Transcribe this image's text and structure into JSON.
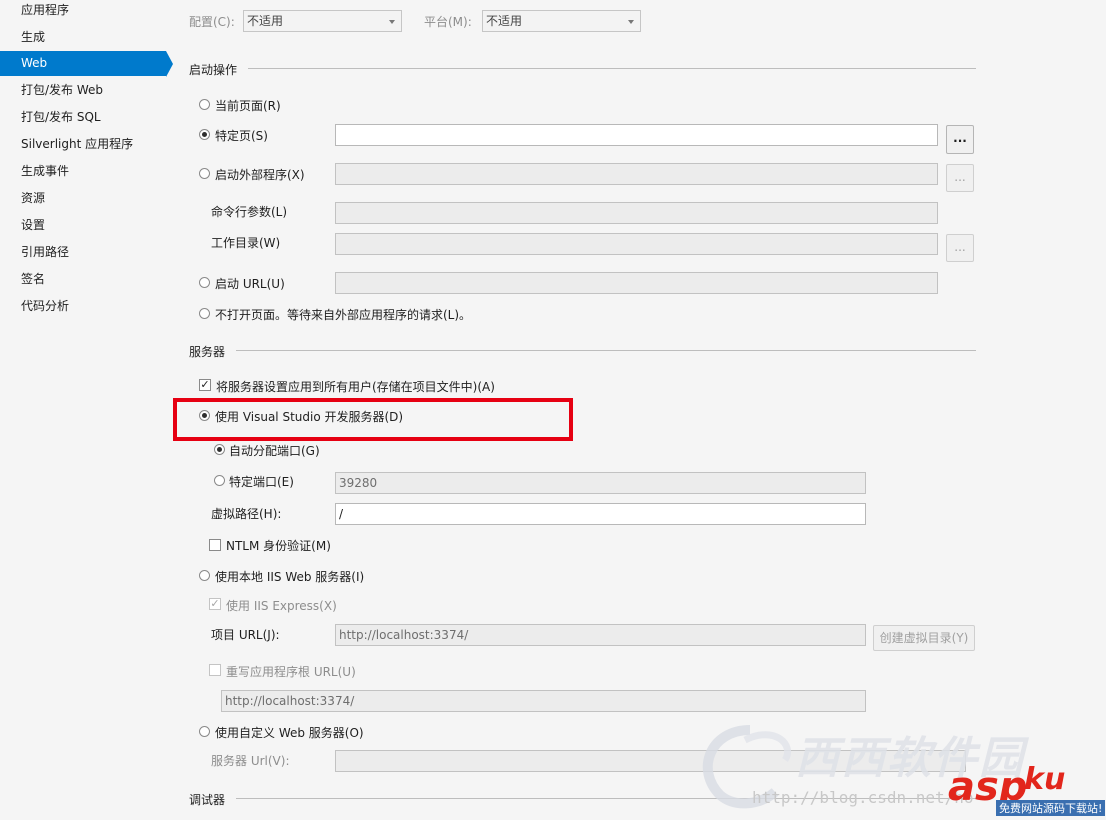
{
  "sidebar": {
    "items": [
      {
        "label": "应用程序",
        "active": false
      },
      {
        "label": "生成",
        "active": false
      },
      {
        "label": "Web",
        "active": true
      },
      {
        "label": "打包/发布 Web",
        "active": false
      },
      {
        "label": "打包/发布 SQL",
        "active": false
      },
      {
        "label": "Silverlight 应用程序",
        "active": false
      },
      {
        "label": "生成事件",
        "active": false
      },
      {
        "label": "资源",
        "active": false
      },
      {
        "label": "设置",
        "active": false
      },
      {
        "label": "引用路径",
        "active": false
      },
      {
        "label": "签名",
        "active": false
      },
      {
        "label": "代码分析",
        "active": false
      }
    ]
  },
  "toolbar": {
    "config_label": "配置(C):",
    "config_value": "不适用",
    "platform_label": "平台(M):",
    "platform_value": "不适用"
  },
  "start_action": {
    "title": "启动操作",
    "current_page": "当前页面(R)",
    "specific_page": "特定页(S)",
    "specific_page_value": "",
    "external_program": "启动外部程序(X)",
    "command_args": "命令行参数(L)",
    "working_dir": "工作目录(W)",
    "start_url": "启动 URL(U)",
    "dont_open": "不打开页面。等待来自外部应用程序的请求(L)。",
    "browse_label": "...",
    "selected": "specific_page"
  },
  "servers": {
    "title": "服务器",
    "apply_all_users": "将服务器设置应用到所有用户(存储在项目文件中)(A)",
    "apply_all_users_checked": true,
    "use_vs_dev": "使用 Visual Studio 开发服务器(D)",
    "auto_port": "自动分配端口(G)",
    "specific_port": "特定端口(E)",
    "port_value": "39280",
    "virtual_path": "虚拟路径(H):",
    "virtual_path_value": "/",
    "ntlm": "NTLM 身份验证(M)",
    "use_local_iis": "使用本地 IIS Web 服务器(I)",
    "use_iis_express": "使用 IIS Express(X)",
    "project_url": "项目 URL(J):",
    "project_url_value": "http://localhost:3374/",
    "create_vdir": "创建虚拟目录(Y)",
    "override_root": "重写应用程序根 URL(U)",
    "override_root_value": "http://localhost:3374/",
    "use_custom": "使用自定义 Web 服务器(O)",
    "server_url": "服务器 Url(V):"
  },
  "debugger": {
    "title": "调试器"
  },
  "watermark": {
    "site_name": "西西软件园",
    "url_text": "http://blog.csdn.net/ho",
    "logo_text": "asp",
    "logo_suffix": "ku",
    "slogan": "免费网站源码下载站!"
  }
}
